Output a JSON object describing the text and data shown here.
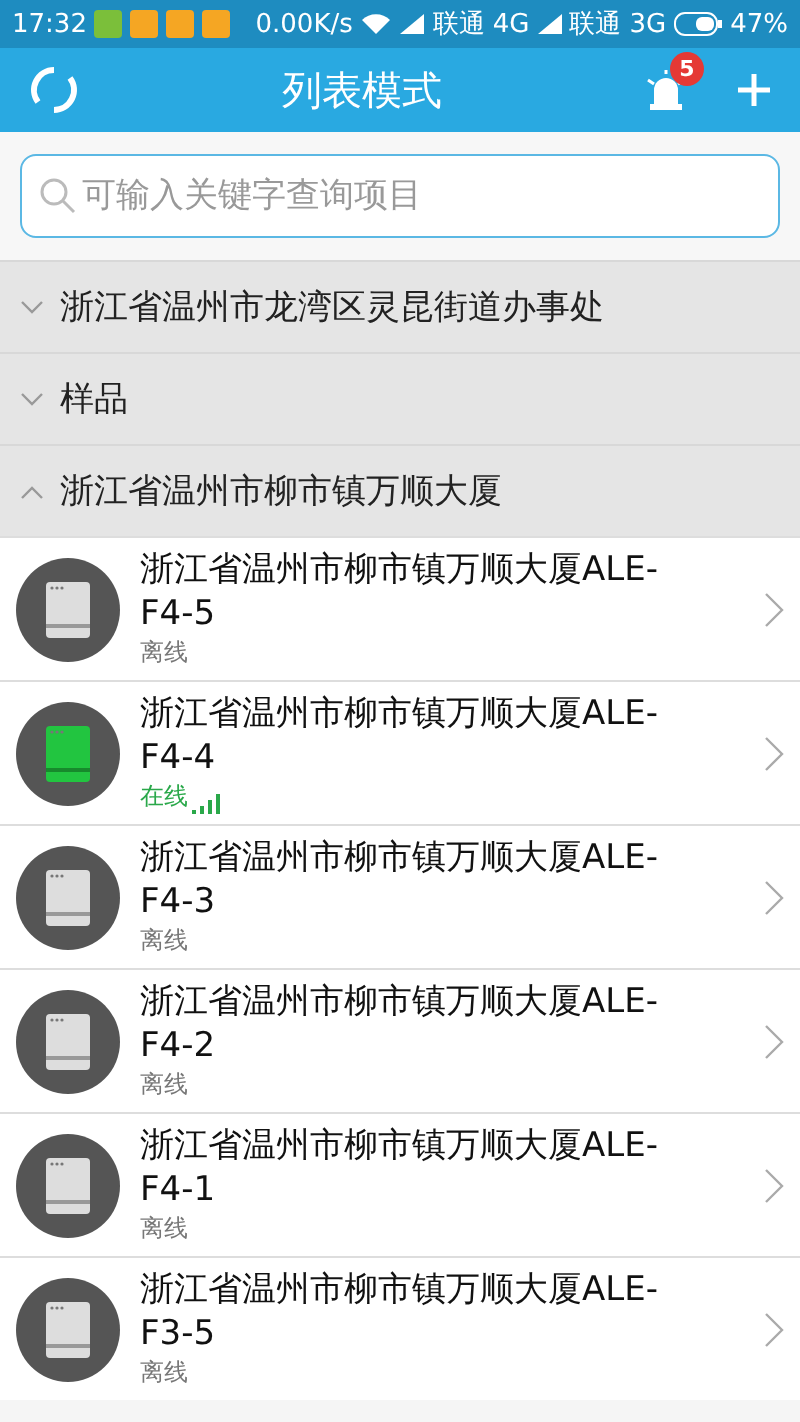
{
  "status_bar": {
    "time": "17:32",
    "speed": "0.00K/s",
    "carriers": [
      {
        "name": "联通",
        "network": "4G"
      },
      {
        "name": "联通",
        "network": "3G"
      }
    ],
    "battery": "47%"
  },
  "app_bar": {
    "title": "列表模式",
    "alarm_badge": "5"
  },
  "search": {
    "placeholder": "可输入关键字查询项目"
  },
  "groups": [
    {
      "name": "浙江省温州市龙湾区灵昆街道办事处",
      "expanded": false
    },
    {
      "name": "样品",
      "expanded": false
    },
    {
      "name": "浙江省温州市柳市镇万顺大厦",
      "expanded": true,
      "devices": [
        {
          "name": "浙江省温州市柳市镇万顺大厦ALE-F4-5",
          "online": false,
          "status": "离线"
        },
        {
          "name": "浙江省温州市柳市镇万顺大厦ALE-F4-4",
          "online": true,
          "status": "在线"
        },
        {
          "name": "浙江省温州市柳市镇万顺大厦ALE-F4-3",
          "online": false,
          "status": "离线"
        },
        {
          "name": "浙江省温州市柳市镇万顺大厦ALE-F4-2",
          "online": false,
          "status": "离线"
        },
        {
          "name": "浙江省温州市柳市镇万顺大厦ALE-F4-1",
          "online": false,
          "status": "离线"
        },
        {
          "name": "浙江省温州市柳市镇万顺大厦ALE-F3-5",
          "online": false,
          "status": "离线"
        }
      ]
    }
  ]
}
